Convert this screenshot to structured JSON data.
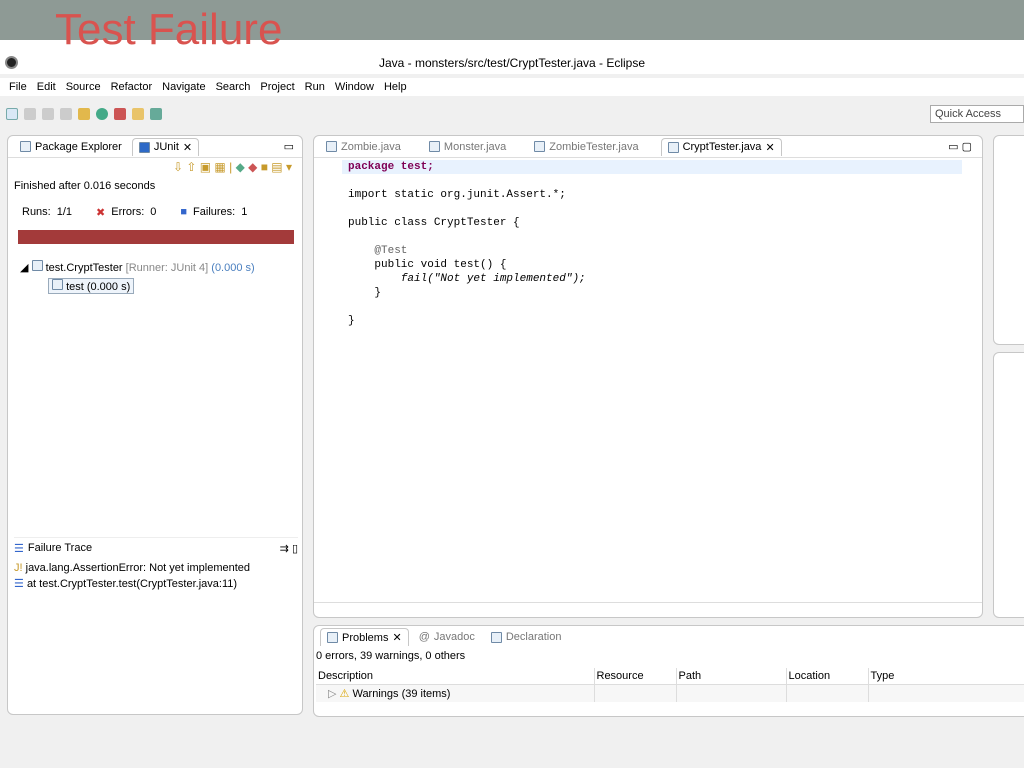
{
  "slide": {
    "title": "Test Failure"
  },
  "window": {
    "title": "Java - monsters/src/test/CryptTester.java - Eclipse"
  },
  "menu": [
    "File",
    "Edit",
    "Source",
    "Refactor",
    "Navigate",
    "Search",
    "Project",
    "Run",
    "Window",
    "Help"
  ],
  "quick_access": "Quick Access",
  "left_panel": {
    "tabs": [
      "Package Explorer",
      "JUnit"
    ],
    "finished": "Finished after 0.016 seconds",
    "runs_label": "Runs:",
    "runs_value": "1/1",
    "errors_label": "Errors:",
    "errors_value": "0",
    "failures_label": "Failures:",
    "failures_value": "1",
    "progress_color": "#a33a3a",
    "tree": [
      {
        "name": "test.CryptTester",
        "runner": "[Runner: JUnit 4]",
        "time": "(0.000 s)"
      },
      {
        "name": "test (0.000 s)"
      }
    ],
    "failure_trace_title": "Failure Trace",
    "trace": [
      "java.lang.AssertionError: Not yet implemented",
      "at test.CryptTester.test(CryptTester.java:11)"
    ]
  },
  "editor": {
    "tabs": [
      "Zombie.java",
      "Monster.java",
      "ZombieTester.java",
      "CryptTester.java"
    ],
    "lines": {
      "l1": "package test;",
      "l2": "import static org.junit.Assert.*;",
      "l3": "public class CryptTester {",
      "l4": "@Test",
      "l5": "public void test() {",
      "l6": "fail(\"Not yet implemented\");",
      "l7": "}",
      "l8": "}"
    }
  },
  "problems": {
    "tabs": [
      "Problems",
      "Javadoc",
      "Declaration"
    ],
    "summary": "0 errors, 39 warnings, 0 others",
    "columns": [
      "Description",
      "Resource",
      "Path",
      "Location",
      "Type"
    ],
    "rows": [
      [
        "Warnings (39 items)",
        "",
        "",
        "",
        ""
      ]
    ]
  }
}
